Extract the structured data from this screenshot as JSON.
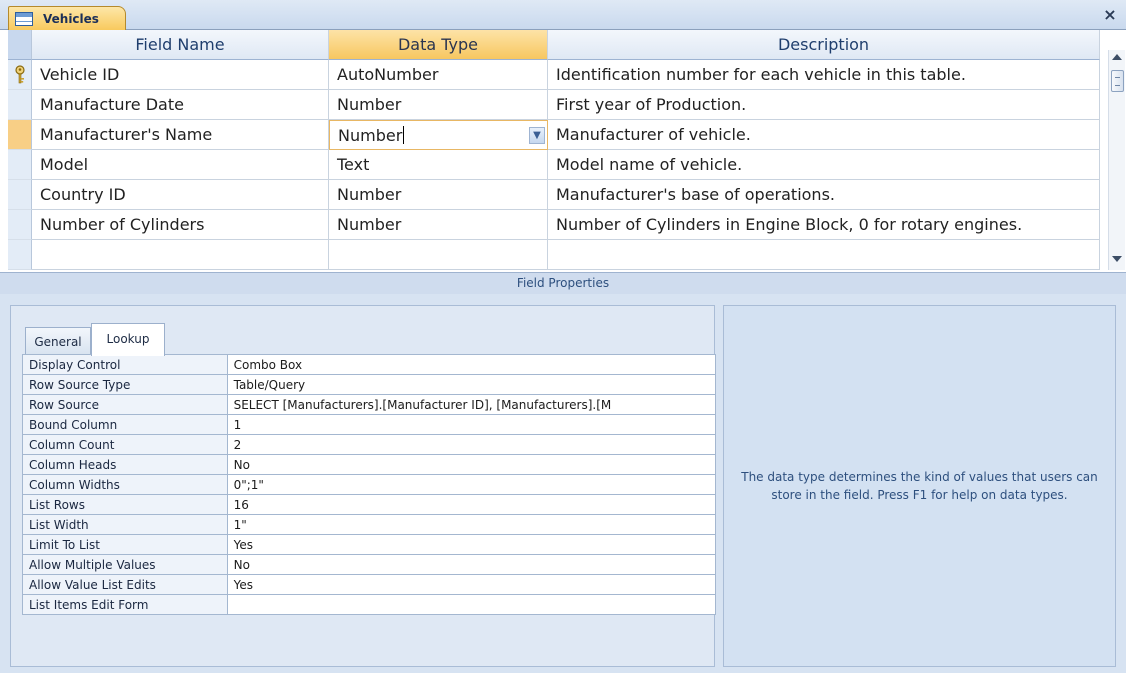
{
  "window": {
    "tab_title": "Vehicles",
    "close_glyph": "×"
  },
  "grid": {
    "headers": {
      "field_name": "Field Name",
      "data_type": "Data Type",
      "description": "Description"
    },
    "rows": [
      {
        "name": "Vehicle ID",
        "type": "AutoNumber",
        "desc": "Identification number for each vehicle in this table.",
        "primary_key": true
      },
      {
        "name": "Manufacture Date",
        "type": "Number",
        "desc": "First year of Production."
      },
      {
        "name": "Manufacturer's Name",
        "type": "Number",
        "desc": "Manufacturer of vehicle.",
        "current": true
      },
      {
        "name": "Model",
        "type": "Text",
        "desc": "Model name of vehicle."
      },
      {
        "name": "Country ID",
        "type": "Number",
        "desc": "Manufacturer's base of operations."
      },
      {
        "name": "Number of Cylinders",
        "type": "Number",
        "desc": "Number of Cylinders in Engine Block, 0 for rotary engines."
      }
    ]
  },
  "field_properties": {
    "title": "Field Properties",
    "tabs": {
      "general": "General",
      "lookup": "Lookup"
    },
    "properties": [
      {
        "label": "Display Control",
        "value": "Combo Box"
      },
      {
        "label": "Row Source Type",
        "value": "Table/Query"
      },
      {
        "label": "Row Source",
        "value": "SELECT [Manufacturers].[Manufacturer ID], [Manufacturers].[M"
      },
      {
        "label": "Bound Column",
        "value": "1"
      },
      {
        "label": "Column Count",
        "value": "2"
      },
      {
        "label": "Column Heads",
        "value": "No"
      },
      {
        "label": "Column Widths",
        "value": "0\";1\""
      },
      {
        "label": "List Rows",
        "value": "16"
      },
      {
        "label": "List Width",
        "value": "1\""
      },
      {
        "label": "Limit To List",
        "value": "Yes"
      },
      {
        "label": "Allow Multiple Values",
        "value": "No"
      },
      {
        "label": "Allow Value List Edits",
        "value": "Yes"
      },
      {
        "label": "List Items Edit Form",
        "value": ""
      }
    ],
    "help_text": "The data type determines the kind of values that users can store in the field.  Press F1 for help on data types."
  },
  "icons": {
    "table": "table-icon",
    "key": "primary-key-icon",
    "dropdown": "chevron-down-icon",
    "close": "close-icon"
  },
  "colors": {
    "active_tab": "#f8c85a",
    "current_row_selector": "#f8cf86",
    "panel_background": "#d7e3f2",
    "help_text": "#2d4f7e"
  }
}
